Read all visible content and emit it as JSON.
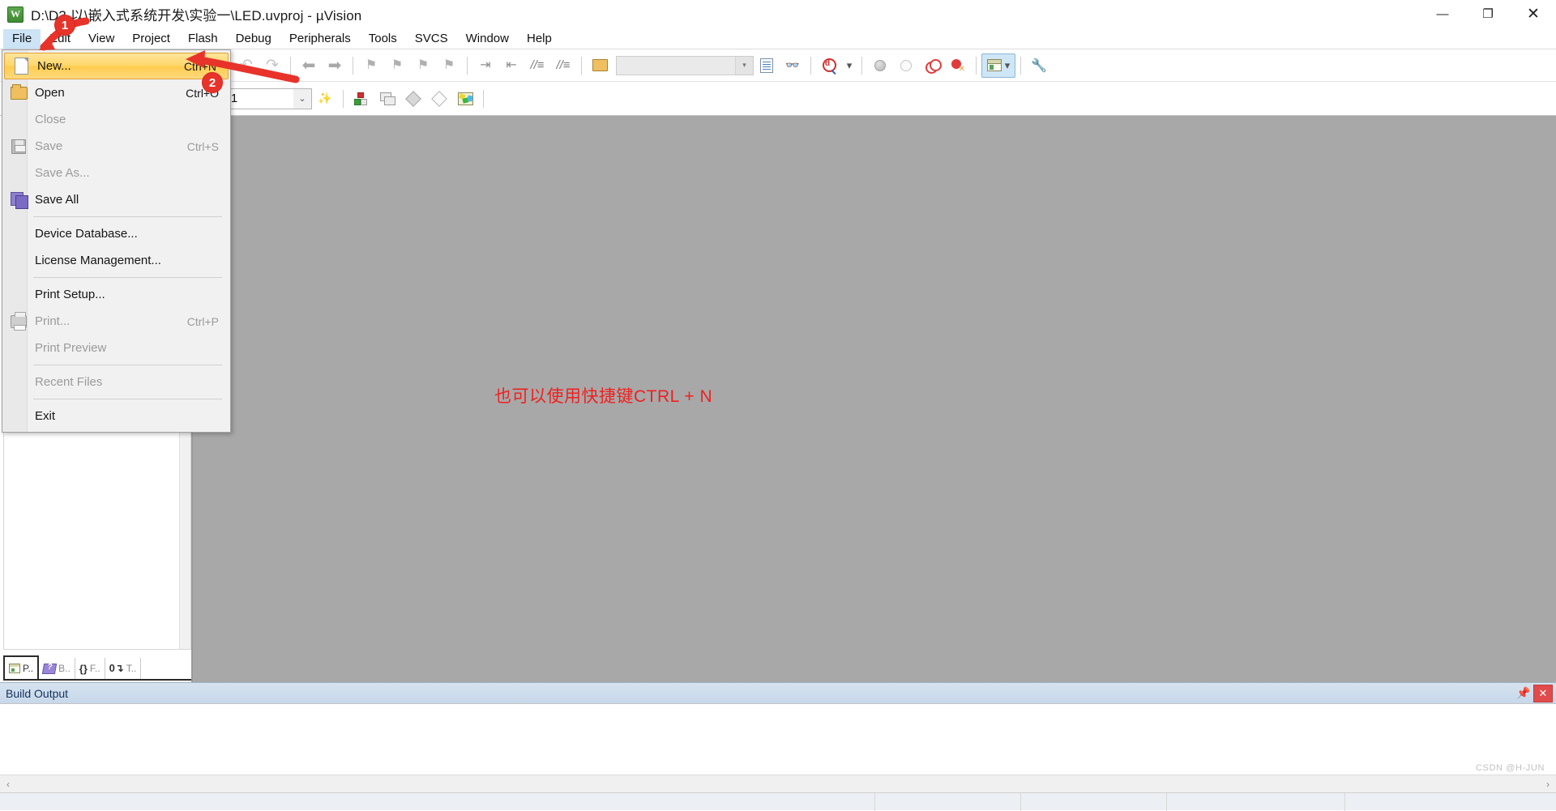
{
  "window": {
    "title": "D:\\D3 以\\嵌入式系统开发\\实验一\\LED.uvproj - µVision",
    "app_icon": "uvision-logo-icon",
    "controls": {
      "minimize": "—",
      "maximize": "❐",
      "close": "✕"
    }
  },
  "menubar": {
    "items": [
      {
        "label": "File",
        "state": "open"
      },
      {
        "label": "Edit",
        "state": "normal"
      },
      {
        "label": "View",
        "state": "normal"
      },
      {
        "label": "Project",
        "state": "normal"
      },
      {
        "label": "Flash",
        "state": "normal"
      },
      {
        "label": "Debug",
        "state": "normal"
      },
      {
        "label": "Peripherals",
        "state": "normal"
      },
      {
        "label": "Tools",
        "state": "normal"
      },
      {
        "label": "SVCS",
        "state": "normal"
      },
      {
        "label": "Window",
        "state": "normal"
      },
      {
        "label": "Help",
        "state": "normal"
      }
    ]
  },
  "file_menu": {
    "items": [
      {
        "label": "New...",
        "accel": "Ctrl+N",
        "icon": "new-file-icon",
        "enabled": true,
        "highlighted": true
      },
      {
        "label": "Open",
        "accel": "Ctrl+O",
        "icon": "open-folder-icon",
        "enabled": true,
        "highlighted": false
      },
      {
        "label": "Close",
        "accel": "",
        "icon": "",
        "enabled": false,
        "highlighted": false
      },
      {
        "label": "Save",
        "accel": "Ctrl+S",
        "icon": "save-disk-icon",
        "enabled": false,
        "highlighted": false
      },
      {
        "label": "Save As...",
        "accel": "",
        "icon": "",
        "enabled": false,
        "highlighted": false
      },
      {
        "label": "Save All",
        "accel": "",
        "icon": "save-all-icon",
        "enabled": true,
        "highlighted": false
      },
      {
        "separator_after": true,
        "label": "",
        "accel": "",
        "icon": "",
        "enabled": true,
        "highlighted": false
      },
      {
        "label": "Device Database...",
        "accel": "",
        "icon": "",
        "enabled": true,
        "highlighted": false
      },
      {
        "label": "License Management...",
        "accel": "",
        "icon": "",
        "enabled": true,
        "highlighted": false
      },
      {
        "label": "Print Setup...",
        "accel": "",
        "icon": "",
        "enabled": true,
        "highlighted": false
      },
      {
        "label": "Print...",
        "accel": "Ctrl+P",
        "icon": "printer-icon",
        "enabled": false,
        "highlighted": false
      },
      {
        "label": "Print Preview",
        "accel": "",
        "icon": "",
        "enabled": false,
        "highlighted": false
      },
      {
        "label": "Recent Files",
        "accel": "",
        "icon": "",
        "enabled": false,
        "highlighted": false
      },
      {
        "label": "Exit",
        "accel": "",
        "icon": "",
        "enabled": true,
        "highlighted": false
      }
    ]
  },
  "toolbar_main": {
    "find_combo_value": "",
    "buttons": [
      "undo-icon",
      "redo-icon",
      "navigate-back-icon",
      "navigate-forward-icon",
      "bookmark-toggle-icon",
      "bookmark-prev-icon",
      "bookmark-next-icon",
      "bookmark-clear-icon",
      "indent-increase-icon",
      "indent-decrease-icon",
      "comment-lines-icon",
      "uncomment-lines-icon",
      "find-in-files-icon",
      "configure-file-icon",
      "binoculars-icon",
      "find-magnifier-icon",
      "find-dropdown-icon",
      "insert-breakpoint-icon",
      "remove-breakpoint-icon",
      "disable-all-breakpoints-icon",
      "kill-all-breakpoints-icon",
      "project-window-icon",
      "project-window-dropdown-icon",
      "configure-target-icon"
    ]
  },
  "toolbar_build": {
    "target_label": "Target 1",
    "target_dropdown": "chevron-down-icon",
    "buttons": [
      "target-options-wizard-icon",
      "build-target-icon",
      "rebuild-all-icon",
      "batch-build-icon",
      "download-icon",
      "manage-components-icon"
    ]
  },
  "project_panel": {
    "tabs": [
      {
        "label": "P..",
        "icon": "project-tab-icon",
        "selected": true
      },
      {
        "label": "B..",
        "icon": "books-tab-icon",
        "selected": false
      },
      {
        "label": "F..",
        "icon": "functions-tab-icon",
        "selected": false
      },
      {
        "label": "T..",
        "icon": "templates-tab-icon",
        "selected": false
      }
    ]
  },
  "annotations": {
    "note_text": "也可以使用快捷键CTRL + N",
    "note_color": "#f02020",
    "badges": [
      {
        "number": "1"
      },
      {
        "number": "2"
      }
    ]
  },
  "build_output": {
    "title": "Build Output",
    "pin_icon": "pin-icon",
    "close_icon": "close-icon",
    "content": ""
  },
  "footer": {
    "watermark": "CSDN @H-JUN",
    "scroll_left_icon": "chevron-left-icon",
    "scroll_right_icon": "chevron-right-icon"
  },
  "colors": {
    "workspace_bg": "#a8a8a8",
    "menu_highlight": "#ffd76a",
    "menubar_selected": "#cde4f7",
    "annotation_red": "#e8332a",
    "build_bar": "#c7d8ea"
  }
}
